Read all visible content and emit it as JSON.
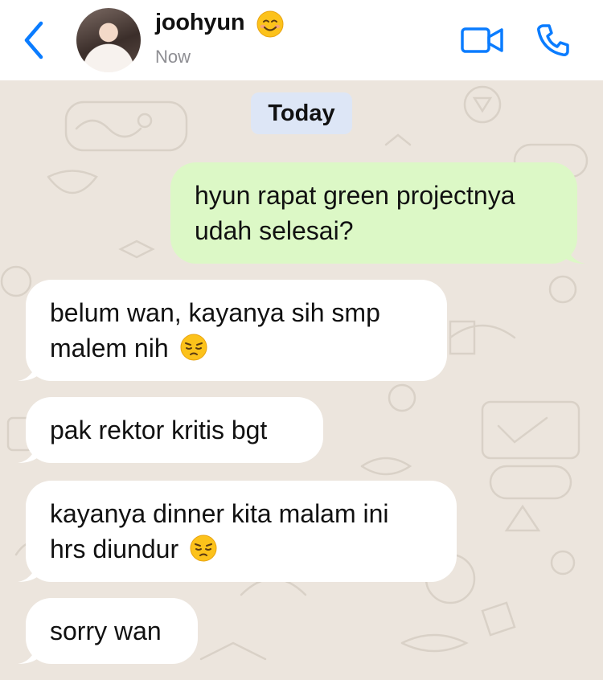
{
  "header": {
    "contact_name": "joohyun",
    "contact_status": "Now",
    "name_emoji": "smiling-face-emoji",
    "back_icon": "chevron-left-icon",
    "video_icon": "video-camera-icon",
    "call_icon": "phone-icon"
  },
  "chat": {
    "date_label": "Today",
    "messages": [
      {
        "direction": "outgoing",
        "line1": "hyun rapat green projectnya",
        "line2": "udah selesai?"
      },
      {
        "direction": "incoming",
        "line1": "belum wan, kayanya sih smp",
        "line2": "malem nih",
        "emoji": "pensive-face-emoji"
      },
      {
        "direction": "incoming",
        "line1": "pak rektor kritis bgt"
      },
      {
        "direction": "incoming",
        "line1": "kayanya dinner kita malam ini",
        "line2": "hrs diundur",
        "emoji": "pensive-face-emoji"
      },
      {
        "direction": "incoming",
        "line1": "sorry wan"
      }
    ]
  },
  "colors": {
    "accent": "#0a7cff",
    "outgoing_bubble": "#dcf8c6",
    "incoming_bubble": "#ffffff",
    "date_chip": "#dde6f6",
    "wallpaper": "#ece5dd"
  }
}
